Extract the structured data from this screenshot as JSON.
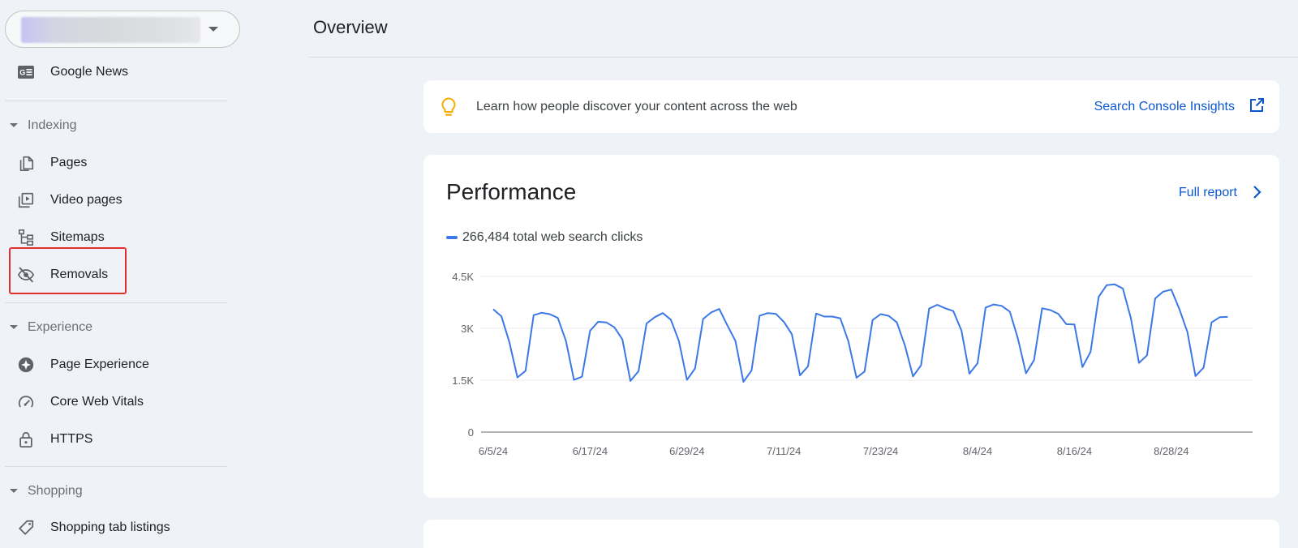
{
  "sidebar": {
    "items": {
      "google_news": "Google News",
      "pages": "Pages",
      "video_pages": "Video pages",
      "sitemaps": "Sitemaps",
      "removals": "Removals",
      "page_experience": "Page Experience",
      "core_web_vitals": "Core Web Vitals",
      "https": "HTTPS",
      "shopping_tab_listings": "Shopping tab listings"
    },
    "sections": {
      "indexing": "Indexing",
      "experience": "Experience",
      "shopping": "Shopping"
    },
    "highlighted_item": "Removals",
    "highlight_color": "#e0312e"
  },
  "header": {
    "title": "Overview"
  },
  "insights": {
    "text": "Learn how people discover your content across the web",
    "link": "Search Console Insights",
    "icon": "lightbulb-icon",
    "icon_color": "#f9ab00",
    "link_color": "#0b57d0"
  },
  "performance": {
    "title": "Performance",
    "full_report": "Full report",
    "legend": "266,484 total web search clicks"
  },
  "chart_data": {
    "type": "line",
    "title": "",
    "xlabel": "",
    "ylabel": "",
    "ylim": [
      0,
      4500
    ],
    "y_ticks": [
      "0",
      "1.5K",
      "3K",
      "4.5K"
    ],
    "y_tick_values": [
      0,
      1500,
      3000,
      4500
    ],
    "x_tick_labels": [
      "6/5/24",
      "6/17/24",
      "6/29/24",
      "7/11/24",
      "7/23/24",
      "8/4/24",
      "8/16/24",
      "8/28/24"
    ],
    "x_start": "6/5/24",
    "x_end": "9/7/24",
    "grid": true,
    "series": [
      {
        "name": "266,484 total web search clicks",
        "color": "#3b78e7",
        "values": [
          3550,
          3350,
          2600,
          1580,
          1770,
          3380,
          3450,
          3410,
          3300,
          2640,
          1510,
          1600,
          2930,
          3190,
          3170,
          3030,
          2680,
          1480,
          1760,
          3140,
          3320,
          3440,
          3250,
          2630,
          1510,
          1840,
          3270,
          3460,
          3560,
          3090,
          2640,
          1450,
          1780,
          3360,
          3440,
          3420,
          3190,
          2830,
          1640,
          1900,
          3430,
          3340,
          3340,
          3290,
          2620,
          1570,
          1750,
          3240,
          3410,
          3360,
          3170,
          2500,
          1610,
          1930,
          3570,
          3680,
          3580,
          3500,
          2940,
          1690,
          1990,
          3600,
          3690,
          3650,
          3480,
          2700,
          1700,
          2080,
          3580,
          3530,
          3420,
          3120,
          3110,
          1880,
          2320,
          3910,
          4250,
          4270,
          4150,
          3290,
          2000,
          2220,
          3860,
          4060,
          4120,
          3560,
          2890,
          1620,
          1860,
          3170,
          3320,
          3330
        ]
      }
    ]
  }
}
